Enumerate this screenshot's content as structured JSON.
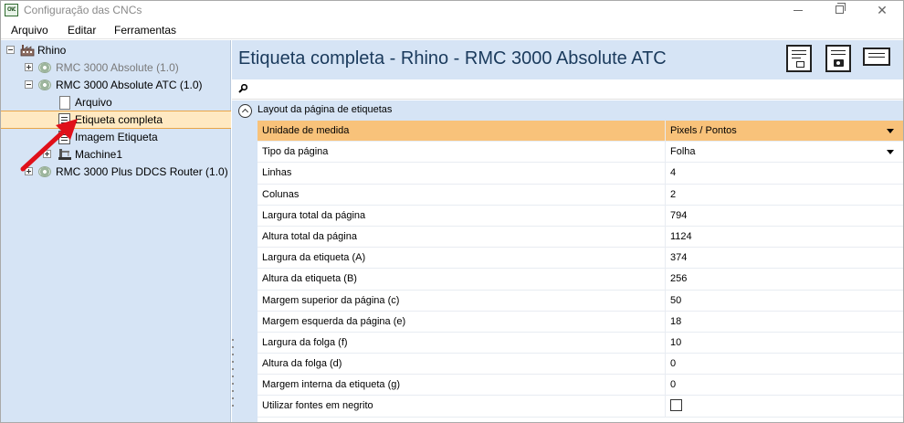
{
  "window": {
    "title": "Configuração das CNCs",
    "app_icon_text": "CNC",
    "controls": [
      "minimize-icon",
      "maximize-icon",
      "close-icon"
    ]
  },
  "menu": {
    "items": [
      "Arquivo",
      "Editar",
      "Ferramentas"
    ]
  },
  "tree": {
    "root": "Rhino",
    "items": [
      {
        "label": "RMC 3000 Absolute (1.0)",
        "state": "collapsed",
        "disabled": true
      },
      {
        "label": "RMC 3000 Absolute ATC (1.0)",
        "state": "expanded",
        "disabled": false
      },
      {
        "label": "Arquivo"
      },
      {
        "label": "Etiqueta completa",
        "selected": true
      },
      {
        "label": "Imagem Etiqueta"
      },
      {
        "label": "Machine1"
      },
      {
        "label": "RMC 3000 Plus DDCS Router (1.0)",
        "state": "collapsed",
        "disabled": false
      }
    ]
  },
  "header": {
    "title": "Etiqueta completa - Rhino - RMC 3000 Absolute ATC"
  },
  "search": {
    "value": "",
    "placeholder": ""
  },
  "properties": {
    "category": "Layout da página de etiquetas",
    "rows": [
      {
        "name": "Unidade de medida",
        "value": "Pixels / Pontos",
        "dropdown": true,
        "selected": true
      },
      {
        "name": "Tipo da página",
        "value": "Folha",
        "dropdown": true
      },
      {
        "name": "Linhas",
        "value": "4"
      },
      {
        "name": "Colunas",
        "value": "2"
      },
      {
        "name": "Largura total da página",
        "value": "794"
      },
      {
        "name": "Altura total da página",
        "value": "1124"
      },
      {
        "name": "Largura da etiqueta (A)",
        "value": "374"
      },
      {
        "name": "Altura da etiqueta (B)",
        "value": "256"
      },
      {
        "name": "Margem superior da página (c)",
        "value": "50"
      },
      {
        "name": "Margem esquerda da página (e)",
        "value": "18"
      },
      {
        "name": "Largura da folga (f)",
        "value": "10"
      },
      {
        "name": "Altura da folga (d)",
        "value": "0"
      },
      {
        "name": "Margem interna da etiqueta (g)",
        "value": "0"
      },
      {
        "name": "Utilizar fontes em negrito",
        "value": "",
        "checkbox": true,
        "checked": false
      }
    ]
  },
  "colors": {
    "pane_bg": "#d6e4f5",
    "selected_tree_bg": "#ffe9c2",
    "selected_row_bg": "#f8c27a",
    "annotation_arrow": "#e0101a",
    "title_text": "#1a3a5c"
  }
}
